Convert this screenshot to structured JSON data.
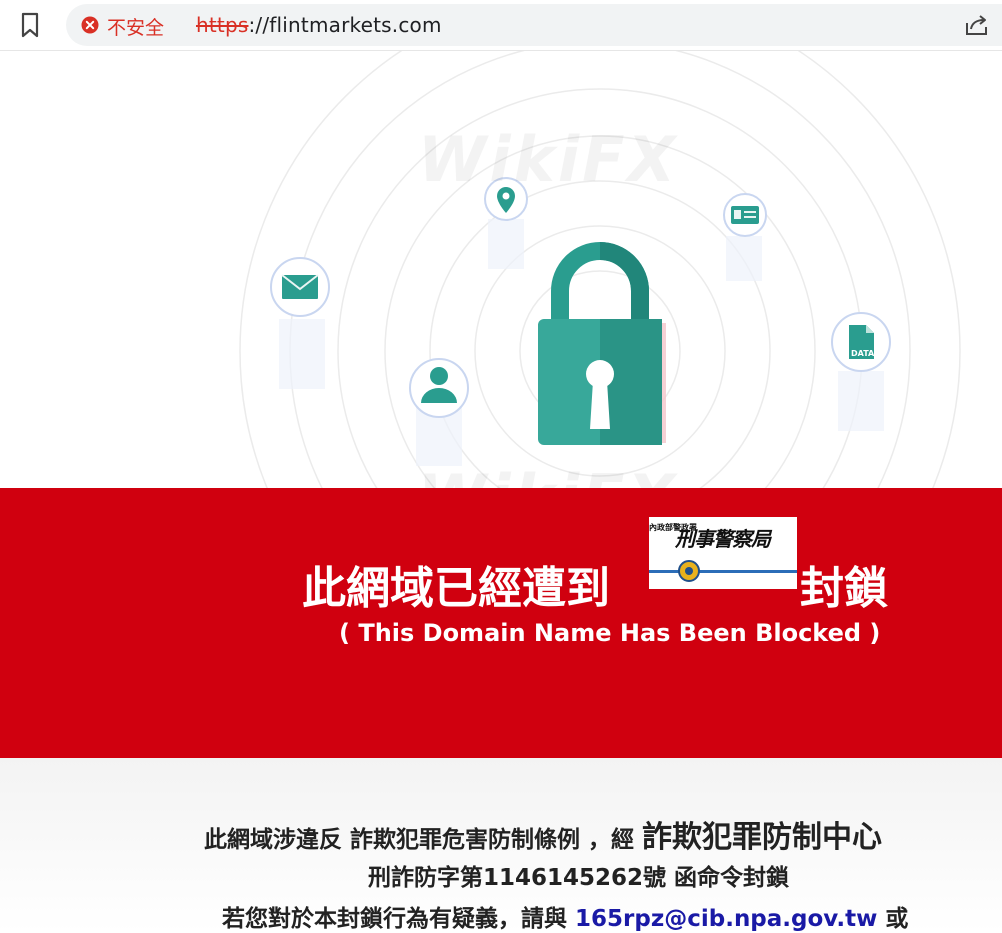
{
  "browser": {
    "security_label": "不安全",
    "url_scheme": "https",
    "url_rest": "://flintmarkets.com",
    "icons": [
      "bookmark-icon",
      "insecure-icon",
      "share-icon"
    ]
  },
  "hero": {
    "watermark": "WikiFX",
    "icons": [
      "location-pin-icon",
      "id-card-icon",
      "mail-icon",
      "user-icon",
      "data-file-icon",
      "lock-icon"
    ],
    "data_file_label": "DATA",
    "accent_color": "#2a9d8f"
  },
  "banner": {
    "title_before": "此網域已經遭到",
    "title_after": "封鎖",
    "logo_text": "刑事警察局",
    "logo_small": "內政部警政署",
    "subtitle": "( This Domain Name Has Been Blocked )",
    "color": "#d0000f"
  },
  "notice": {
    "line1_a": "此網域涉違反 詐欺犯罪危害防制條例 ，經 ",
    "line1_b": "詐欺犯罪防制中心",
    "line2": "刑詐防字第1146145262號 函命令封鎖",
    "line3_a": "若您對於本封鎖行為有疑義，請與 ",
    "line3_email": "165rpz@cib.npa.gov.tw",
    "line3_b": " 或"
  }
}
